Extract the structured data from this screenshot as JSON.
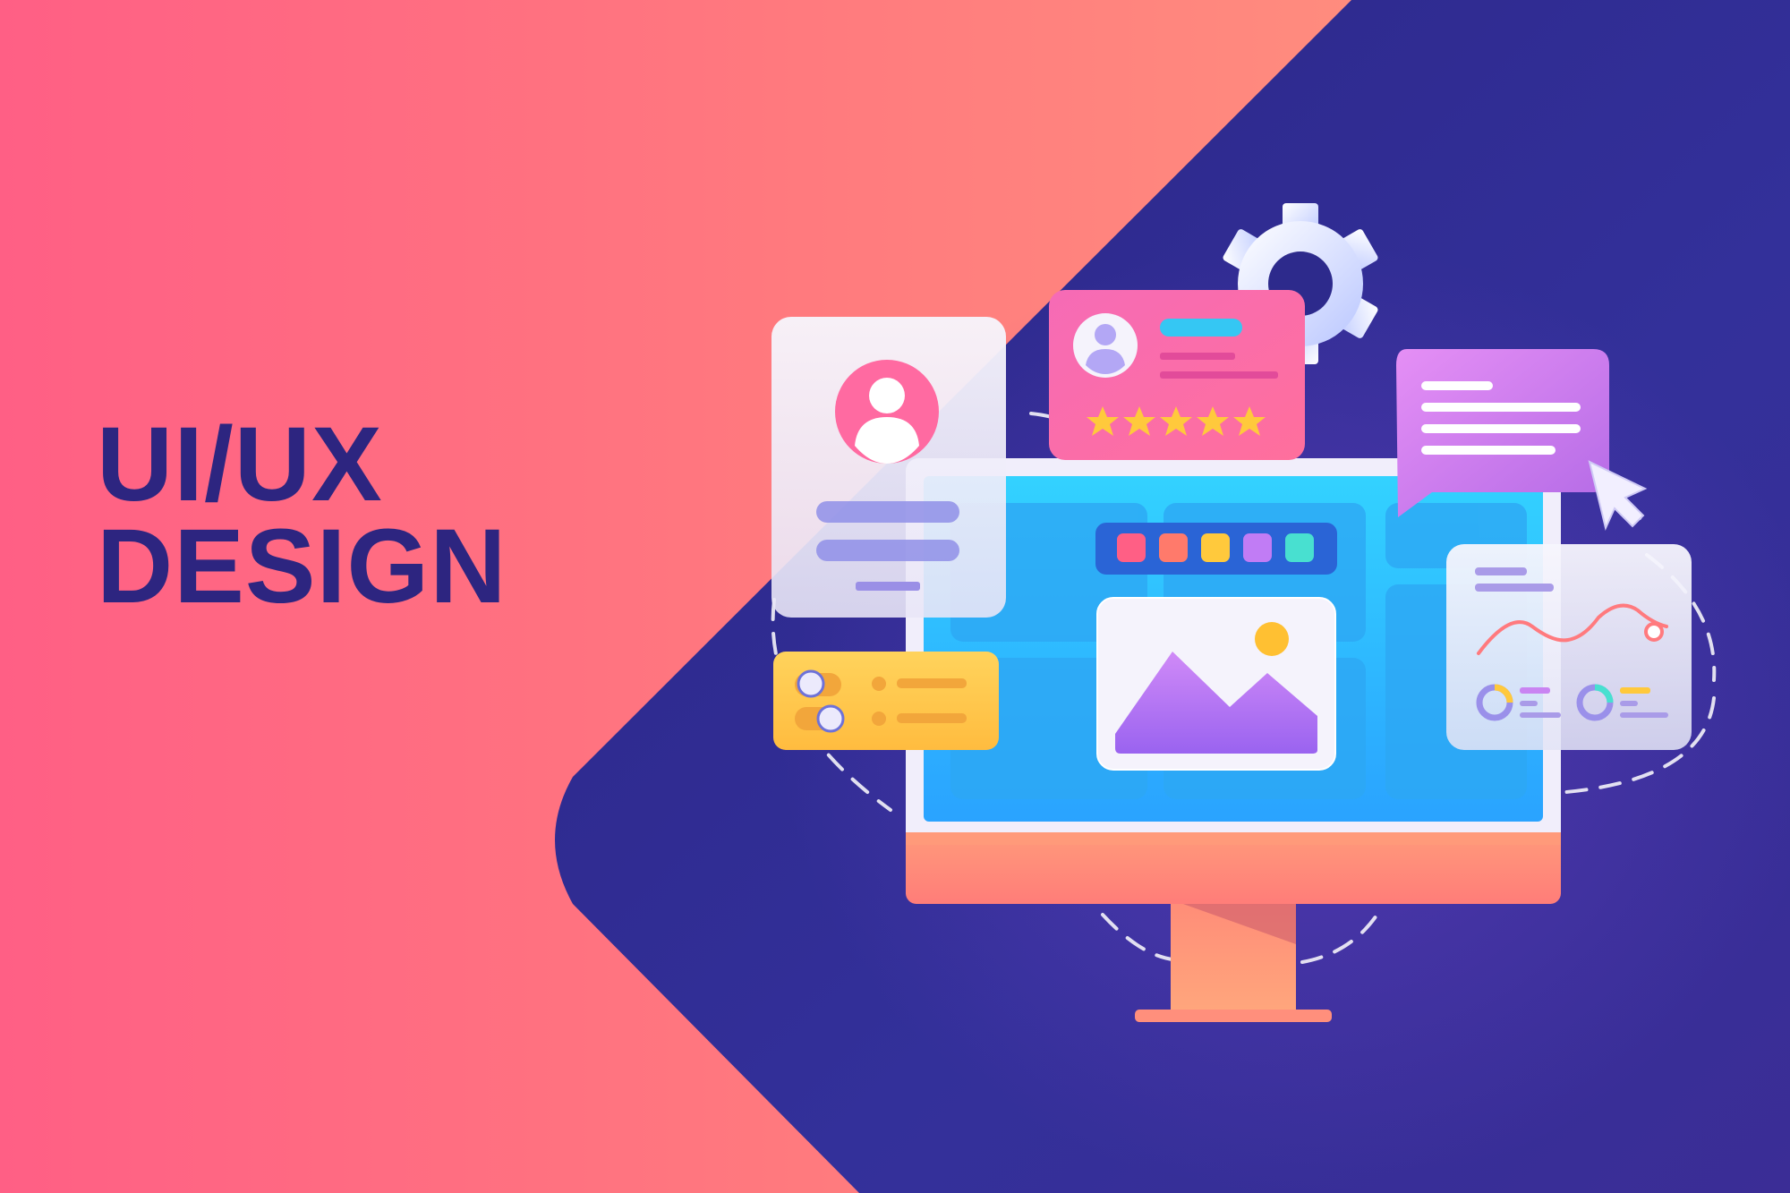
{
  "hero": {
    "title_line1": "UI/UX",
    "title_line2": "DESIGN"
  },
  "illustration": {
    "icons": [
      "gear-icon",
      "user-avatar-icon",
      "star-icon",
      "cursor-arrow-icon",
      "image-mountain-icon",
      "sun-icon",
      "toggle-icon",
      "line-chart-icon",
      "donut-chart-icon"
    ],
    "rating_stars": 5,
    "palette": {
      "background_left": "#ff5f85",
      "background_right": "#ff9a7d",
      "diamond": "#2d2a8c",
      "title": "#2d2580",
      "screen": "#2ec6ff",
      "monitor_base": "#ff8a7a",
      "profile_card": "#f4f2fb",
      "review_card": "#f85fae",
      "chat_bubble": "#d98af0",
      "toggle_card": "#ffc94d",
      "star": "#ffc93c"
    },
    "swatches": [
      "#ff5f85",
      "#ff7a6b",
      "#ffc93c",
      "#c17cf5",
      "#48e0d0"
    ]
  }
}
